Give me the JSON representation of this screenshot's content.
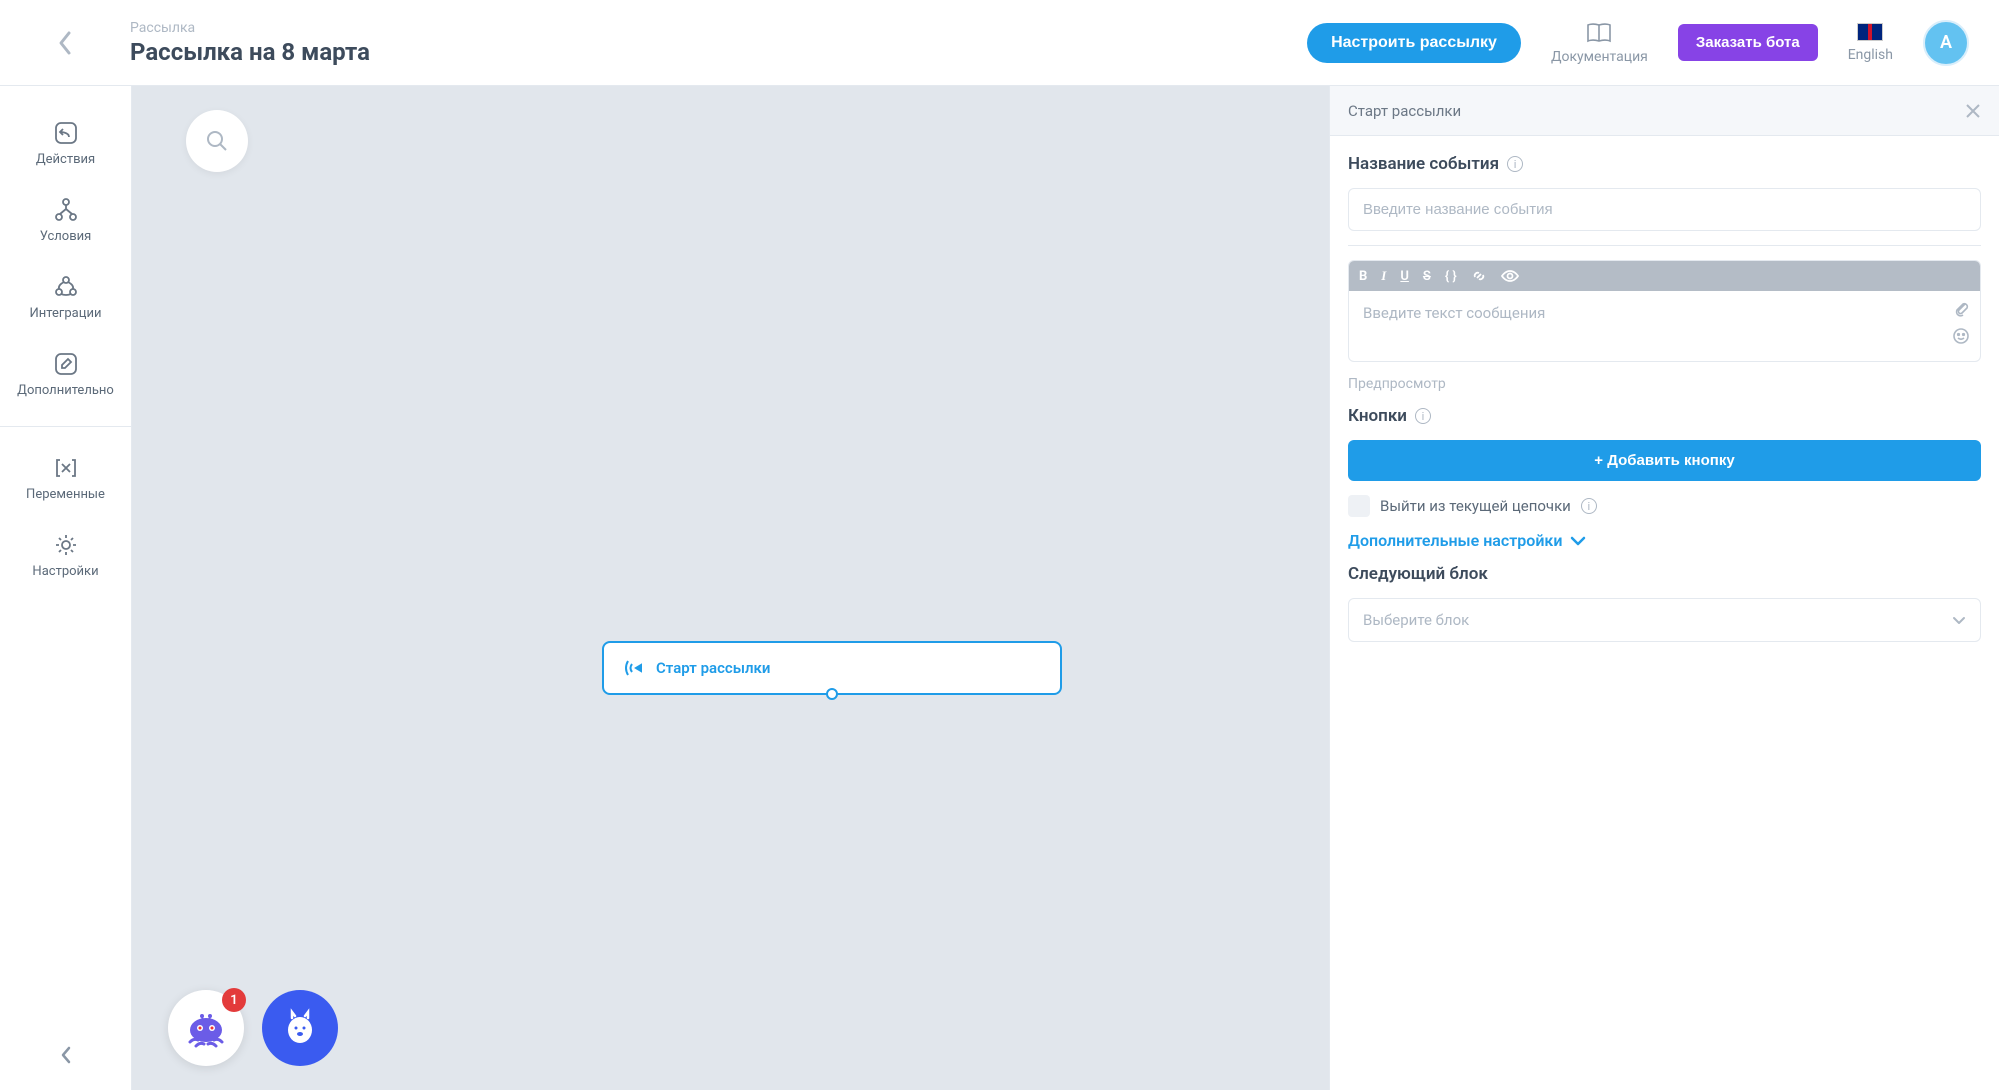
{
  "header": {
    "breadcrumb": "Рассылка",
    "title": "Рассылка на 8 марта",
    "configure_button": "Настроить рассылку",
    "docs_label": "Документация",
    "order_bot_button": "Заказать бота",
    "language_label": "English",
    "avatar_letter": "A"
  },
  "sidebar": {
    "actions": "Действия",
    "conditions": "Условия",
    "integrations": "Интеграции",
    "additional": "Дополнительно",
    "variables": "Переменные",
    "settings": "Настройки"
  },
  "canvas": {
    "node_title": "Старт рассылки",
    "badge_count": "1"
  },
  "panel": {
    "header": "Старт рассылки",
    "event_name_label": "Название события",
    "event_name_placeholder": "Введите название события",
    "message_placeholder": "Введите текст сообщения",
    "preview_label": "Предпросмотр",
    "buttons_label": "Кнопки",
    "add_button_label": "+ Добавить кнопку",
    "exit_chain_label": "Выйти из текущей цепочки",
    "advanced_label": "Дополнительные настройки",
    "next_block_label": "Следующий блок",
    "next_block_placeholder": "Выберите блок"
  }
}
